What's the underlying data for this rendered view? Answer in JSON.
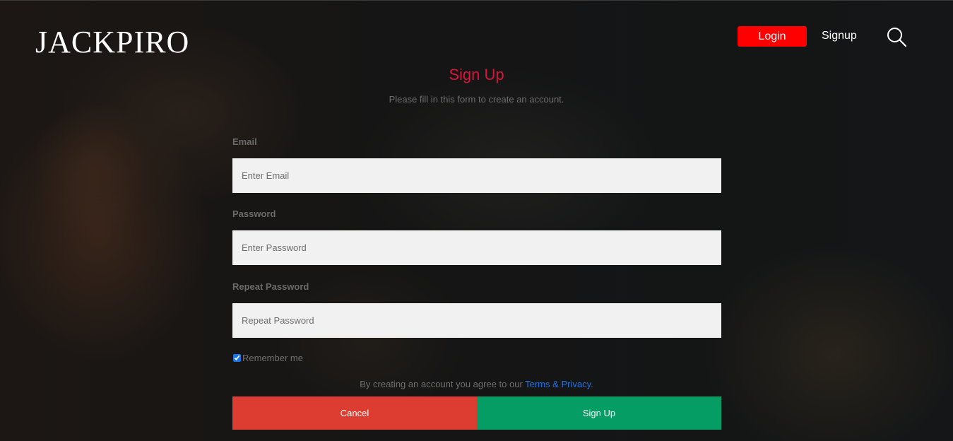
{
  "header": {
    "logo": "JACKPIRO",
    "login_label": "Login",
    "signup_label": "Signup",
    "search_icon": "search-icon"
  },
  "form": {
    "title": "Sign Up",
    "subtitle": "Please fill in this form to create an account.",
    "email": {
      "label": "Email",
      "placeholder": "Enter Email",
      "value": ""
    },
    "password": {
      "label": "Password",
      "placeholder": "Enter Password",
      "value": ""
    },
    "repeat_password": {
      "label": "Repeat Password",
      "placeholder": "Repeat Password",
      "value": ""
    },
    "remember": {
      "label": "Remember me",
      "checked": true
    },
    "terms_text": "By creating an account you agree to our ",
    "terms_link": "Terms & Privacy",
    "terms_period": ".",
    "cancel_label": "Cancel",
    "submit_label": "Sign Up"
  },
  "colors": {
    "accent_red": "#ff0000",
    "title_red": "#dc143c",
    "cancel_red": "#dc3d30",
    "signup_green": "#069d64",
    "link_blue": "#1e74e8"
  }
}
